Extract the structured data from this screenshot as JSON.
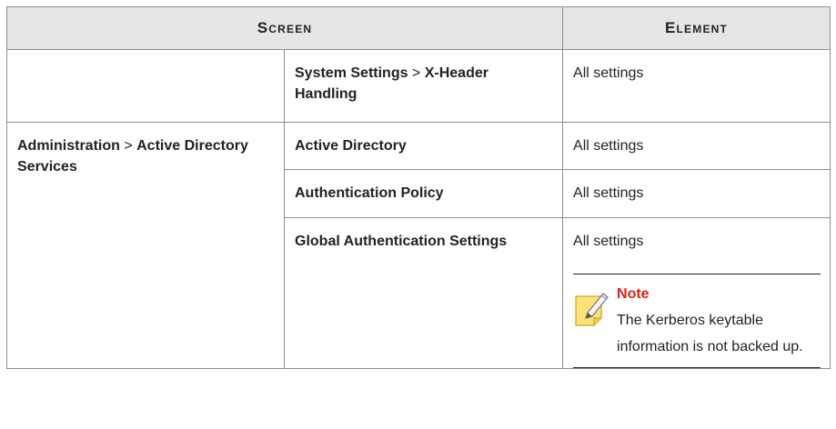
{
  "headers": {
    "screen": "Screen",
    "element": "Element"
  },
  "rows": [
    {
      "screen_col2_main": "System Settings",
      "screen_col2_sep": " > ",
      "screen_col2_sub": "X-Header Handling",
      "element": "All settings"
    },
    {
      "group_main": "Administration",
      "group_sep": " > ",
      "group_sub": "Active Directory Services",
      "screen": "Active Directory",
      "element": "All settings"
    },
    {
      "screen": "Authentication Policy",
      "element": "All settings"
    },
    {
      "screen": "Global Authentication Settings",
      "element": "All settings",
      "note": {
        "title": "Note",
        "text": "The Kerberos keytable information is not backed up."
      }
    }
  ],
  "colors": {
    "header_bg": "#e6e6e6",
    "note_title": "#e0201b",
    "border": "#8f8f8f"
  },
  "icons": {
    "note": "note-pencil-icon"
  }
}
